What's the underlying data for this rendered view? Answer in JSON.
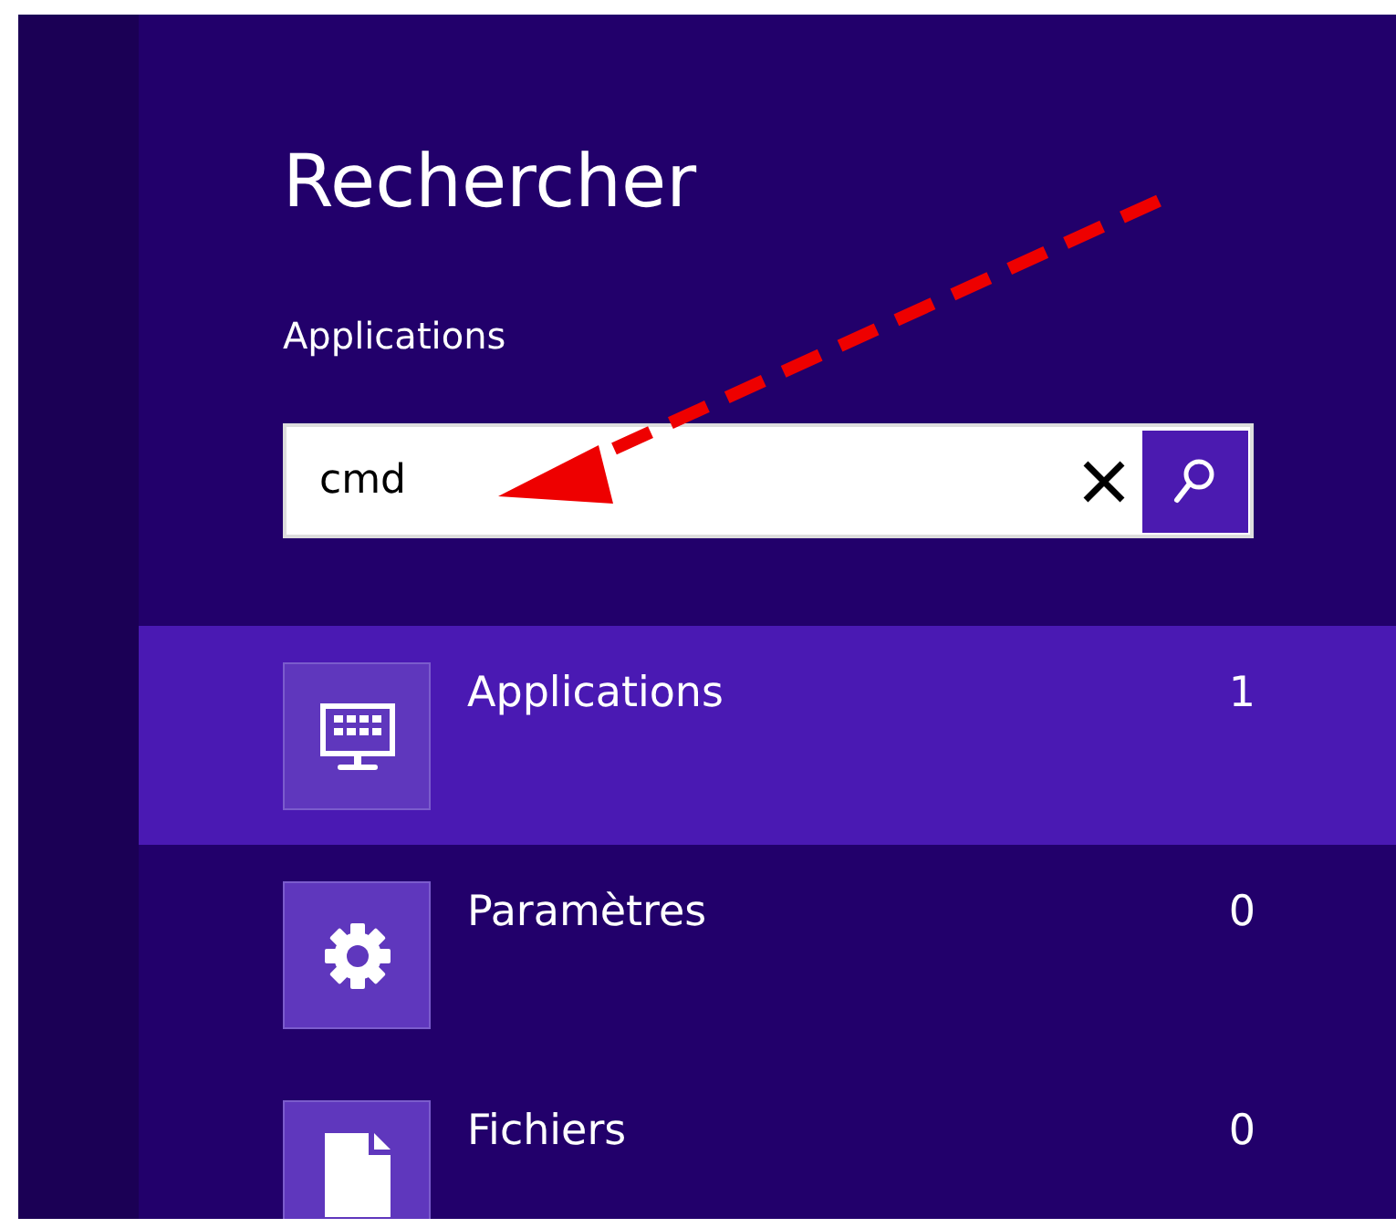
{
  "title": "Rechercher",
  "scope_label": "Applications",
  "search": {
    "value": "cmd"
  },
  "results": [
    {
      "kind": "apps",
      "label": "Applications",
      "count": "1",
      "selected": true
    },
    {
      "kind": "settings",
      "label": "Paramètres",
      "count": "0",
      "selected": false
    },
    {
      "kind": "files",
      "label": "Fichiers",
      "count": "0",
      "selected": false
    }
  ]
}
